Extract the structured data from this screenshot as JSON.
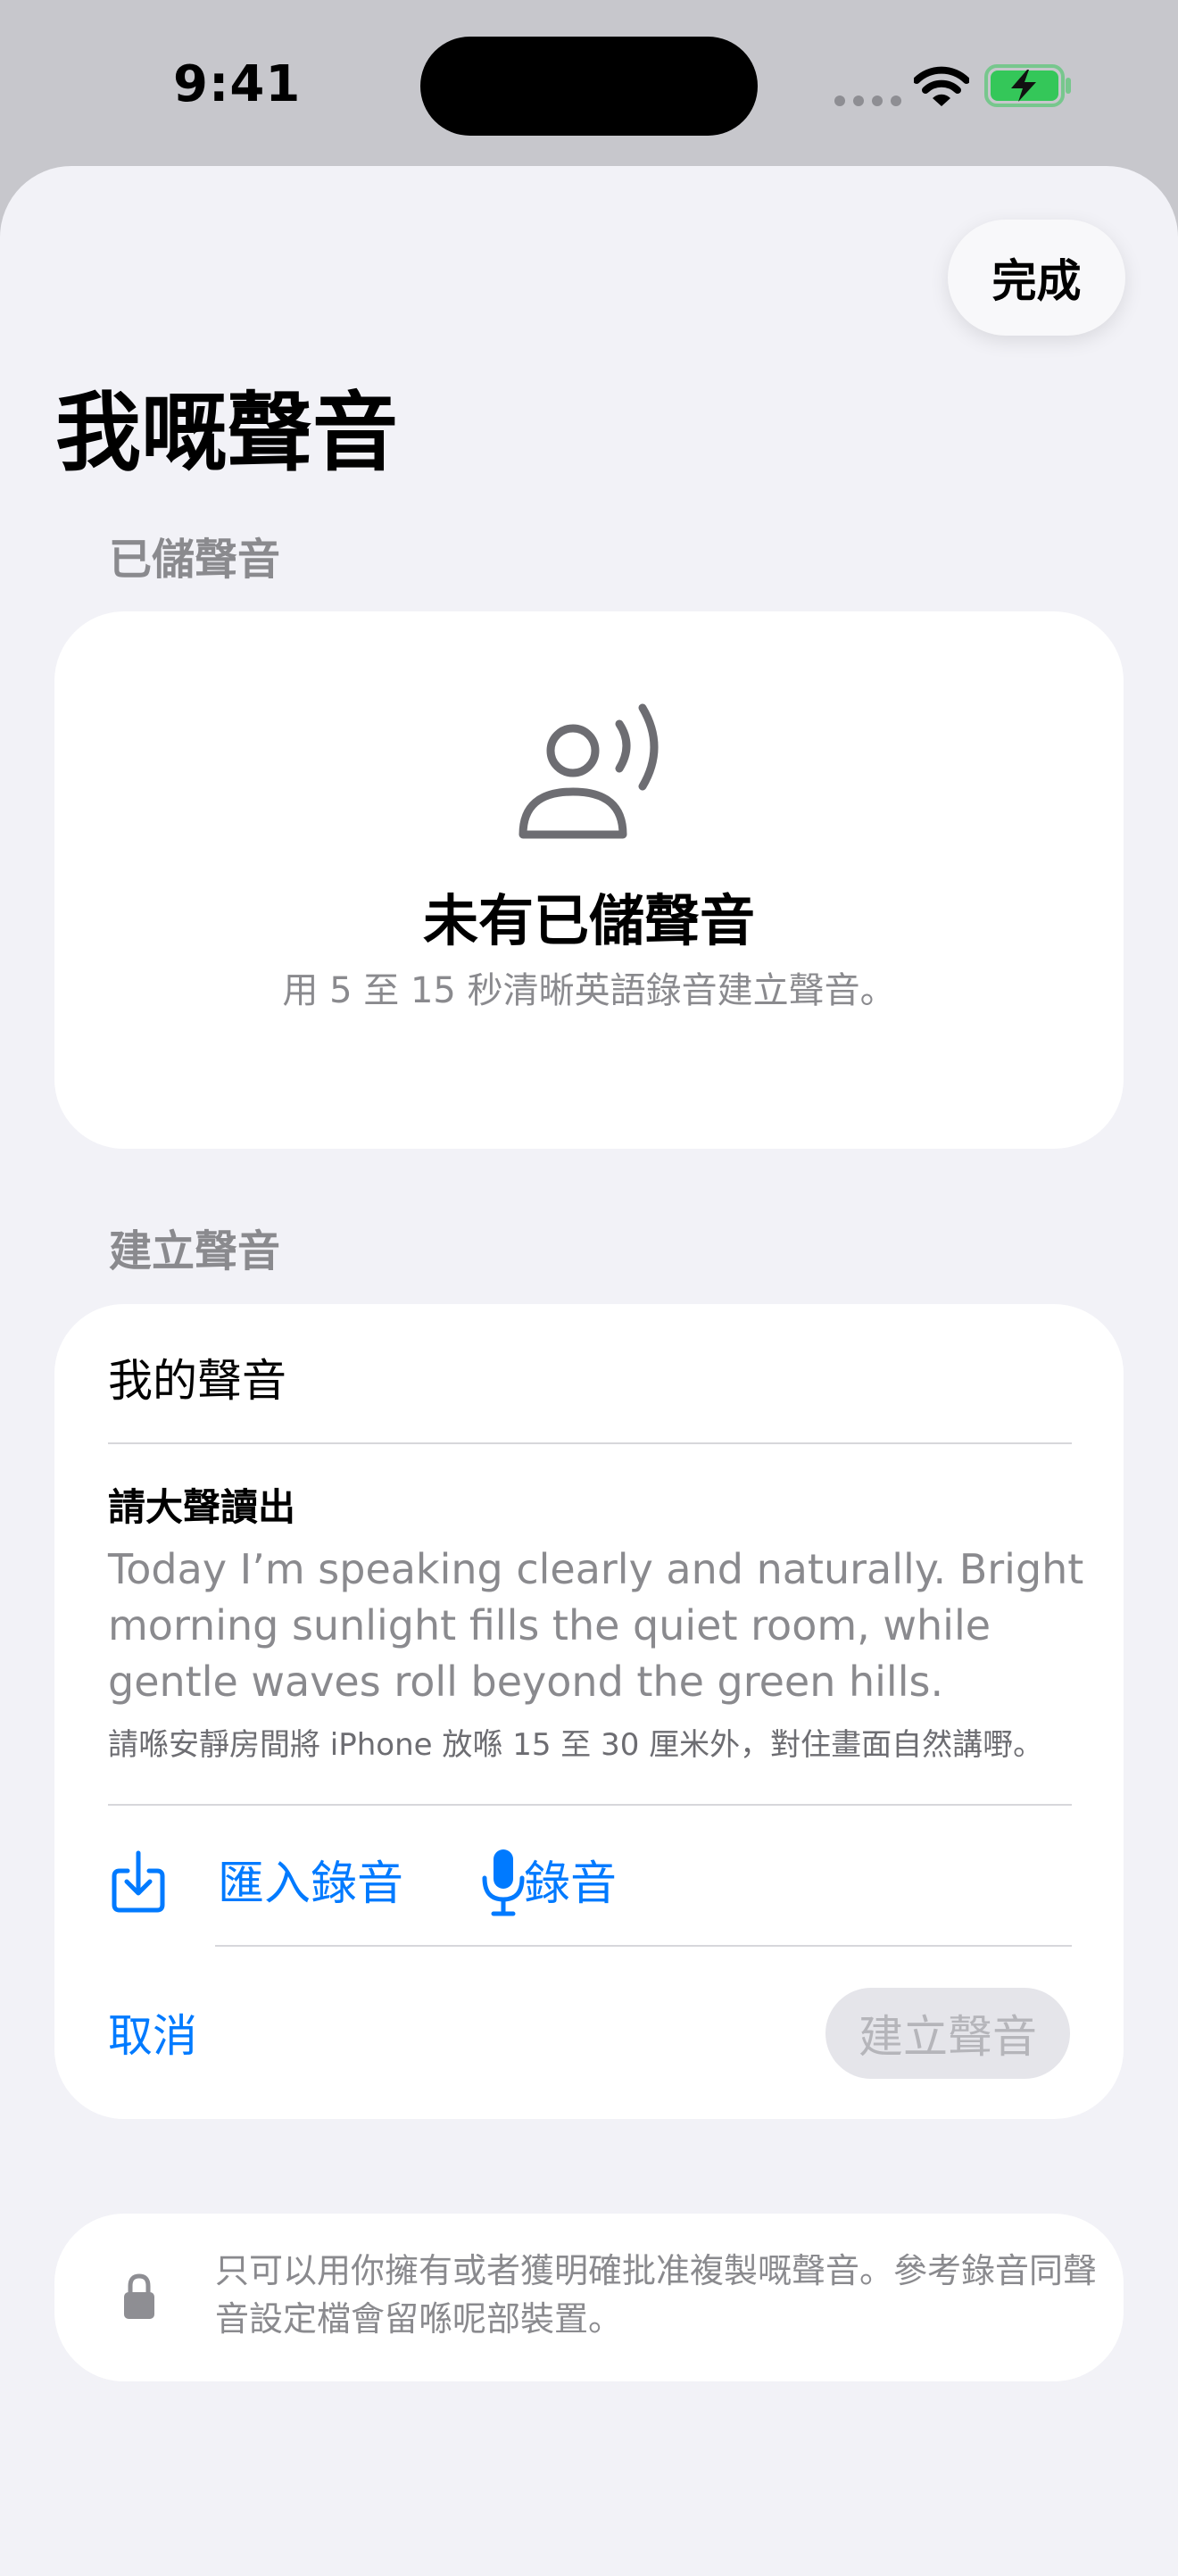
{
  "status_bar": {
    "time": "9:41",
    "icons": [
      "signal-dots-icon",
      "wifi-icon",
      "battery-charging-icon"
    ],
    "battery_color": "#34c759"
  },
  "header": {
    "done_label": "完成",
    "title": "我嘅聲音"
  },
  "saved_voices": {
    "section_title": "已儲聲音",
    "icon": "voice-person-icon",
    "empty_title": "未有已儲聲音",
    "empty_subtitle": "用 5 至 15 秒清晰英語錄音建立聲音。"
  },
  "create_voice": {
    "section_title": "建立聲音",
    "name_value": "我的聲音",
    "read_aloud_label": "請大聲讀出",
    "read_aloud_text": "Today I’m speaking clearly and naturally. Bright morning sunlight fills the quiet room, while gentle waves roll beyond the green hills.",
    "hint": "請喺安靜房間將 iPhone 放喺 15 至 30 厘米外，對住畫面自然講嘢。",
    "import_label": "匯入錄音",
    "record_label": "錄音",
    "cancel_label": "取消",
    "create_label": "建立聲音",
    "accent_color": "#007aff"
  },
  "disclaimer": {
    "icon": "lock-icon",
    "text": "只可以用你擁有或者獲明確批准複製嘅聲音。參考錄音同聲音設定檔會留喺呢部裝置。"
  }
}
